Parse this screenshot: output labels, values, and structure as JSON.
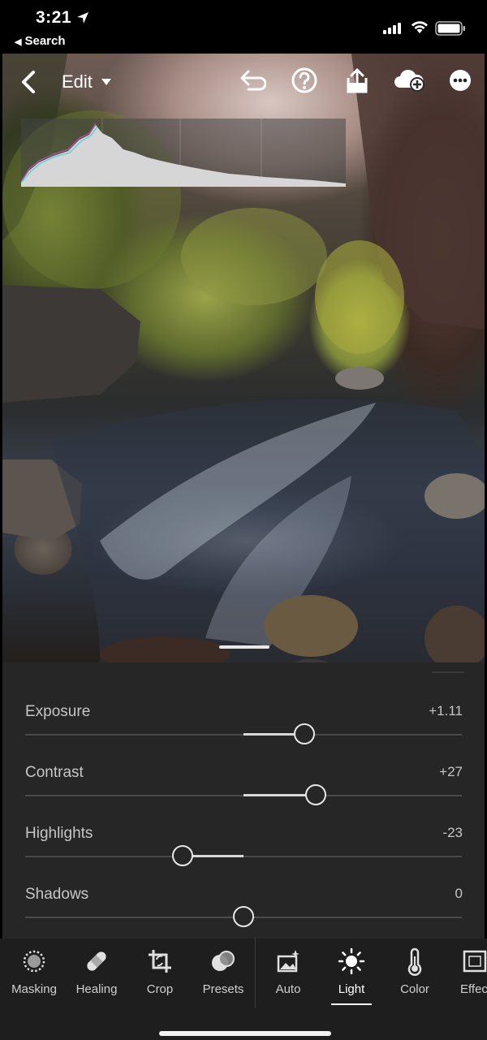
{
  "status_bar": {
    "time": "3:21",
    "back_app": "Search"
  },
  "top_bar": {
    "mode_label": "Edit",
    "icons": [
      "back-chevron-icon",
      "undo-icon",
      "help-icon",
      "share-icon",
      "cloud-add-icon",
      "more-icon"
    ]
  },
  "adjustments": [
    {
      "label": "Exposure",
      "value": "+1.11",
      "level": 0.64
    },
    {
      "label": "Contrast",
      "value": "+27",
      "level": 0.665
    },
    {
      "label": "Highlights",
      "value": "-23",
      "level": 0.36
    },
    {
      "label": "Shadows",
      "value": "0",
      "level": 0.5
    }
  ],
  "tools": [
    {
      "label": "Masking",
      "icon": "masking-icon"
    },
    {
      "label": "Healing",
      "icon": "bandage-icon"
    },
    {
      "label": "Crop",
      "icon": "crop-icon"
    },
    {
      "label": "Presets",
      "icon": "presets-icon"
    },
    {
      "label": "Auto",
      "icon": "auto-image-icon"
    },
    {
      "label": "Light",
      "icon": "sun-icon",
      "active": true
    },
    {
      "label": "Color",
      "icon": "thermometer-icon"
    },
    {
      "label": "Effec",
      "icon": "effects-icon"
    }
  ]
}
